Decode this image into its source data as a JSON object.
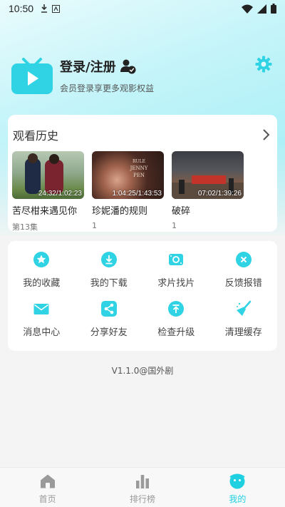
{
  "status_bar": {
    "time": "10:50"
  },
  "profile": {
    "login_label": "登录/注册",
    "subtitle": "会员登录享更多观影权益"
  },
  "history": {
    "title": "观看历史",
    "items": [
      {
        "title": "苦尽柑来遇见你",
        "progress": "24:32/1:02:23",
        "sub": "第13集"
      },
      {
        "title": "珍妮潘的规则",
        "progress": "1:04:25/1:43:53",
        "sub": "1"
      },
      {
        "title": "破碎",
        "progress": "07:02/1:39:26",
        "sub": "1"
      }
    ]
  },
  "menu": {
    "items": [
      {
        "label": "我的收藏",
        "icon": "star-icon"
      },
      {
        "label": "我的下载",
        "icon": "download-icon"
      },
      {
        "label": "求片找片",
        "icon": "film-search-icon"
      },
      {
        "label": "反馈报错",
        "icon": "close-circle-icon"
      },
      {
        "label": "消息中心",
        "icon": "mail-icon"
      },
      {
        "label": "分享好友",
        "icon": "share-icon"
      },
      {
        "label": "检查升级",
        "icon": "upgrade-icon"
      },
      {
        "label": "清理缓存",
        "icon": "broom-icon"
      }
    ]
  },
  "version": "V1.1.0@国外剧",
  "bottom_nav": {
    "items": [
      {
        "label": "首页",
        "icon": "home-icon"
      },
      {
        "label": "排行榜",
        "icon": "ranking-icon"
      },
      {
        "label": "我的",
        "icon": "mine-icon"
      }
    ],
    "active_index": 2
  },
  "colors": {
    "accent": "#1fd0e0",
    "icon_bg": "#2fd3e3",
    "inactive_nav": "#9a9a9a"
  }
}
